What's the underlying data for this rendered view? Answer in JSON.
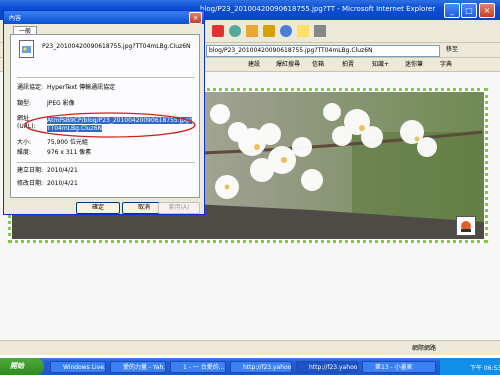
{
  "browser": {
    "title": "blog/P23_20100420090618755.jpg?TT - Microsoft Internet Explorer",
    "address": "blog/P23_20100420090618755.jpg?TT04mLBg.Cluz6N",
    "go_label": "移至",
    "links": [
      "建設",
      "爆紅搜尋",
      "信箱",
      "拍賣",
      "知識+",
      "迷你筆",
      "字典"
    ],
    "status": "網際網路"
  },
  "dialog": {
    "title": "內容",
    "tab": "一般",
    "file_name": "P23_20100420090618755.jpg?TT04mLBg.Cluz6N",
    "rows": {
      "protocol_label": "通訊協定:",
      "protocol_value": "HyperText 傳輸通訊協定",
      "type_label": "類型:",
      "type_value": "JPEG 影像",
      "address_label_1": "網址",
      "address_label_2": "(URL):",
      "address_value": "AtmPsB9CP/blog/P23_20100420090618755.jpg?TT04mLBg.Cluz6N",
      "size_label": "大小:",
      "size_value": "75,900 位元組",
      "dim_label": "維度:",
      "dim_value": "976 x 311 像素",
      "created_label": "建立日期:",
      "created_value": "2010/4/21",
      "modified_label": "修改日期:",
      "modified_value": "2010/4/21"
    },
    "buttons": {
      "ok": "確定",
      "cancel": "取消",
      "apply": "套用(A)"
    }
  },
  "taskbar": {
    "start": "開始",
    "tasks": [
      "Windows Live...",
      "愛的力量 - Yah...",
      "1 - 一 台愛的...",
      "http://f23.yahoof...",
      "http://f23.yahoof...",
      "第13 - 小畫家"
    ],
    "clock": "下午 06:53"
  },
  "colors": {
    "xp_blue": "#0a4fd4",
    "frame_green": "#7ec84b",
    "highlight": "#316ac5",
    "annotation_red": "#d0201a"
  }
}
